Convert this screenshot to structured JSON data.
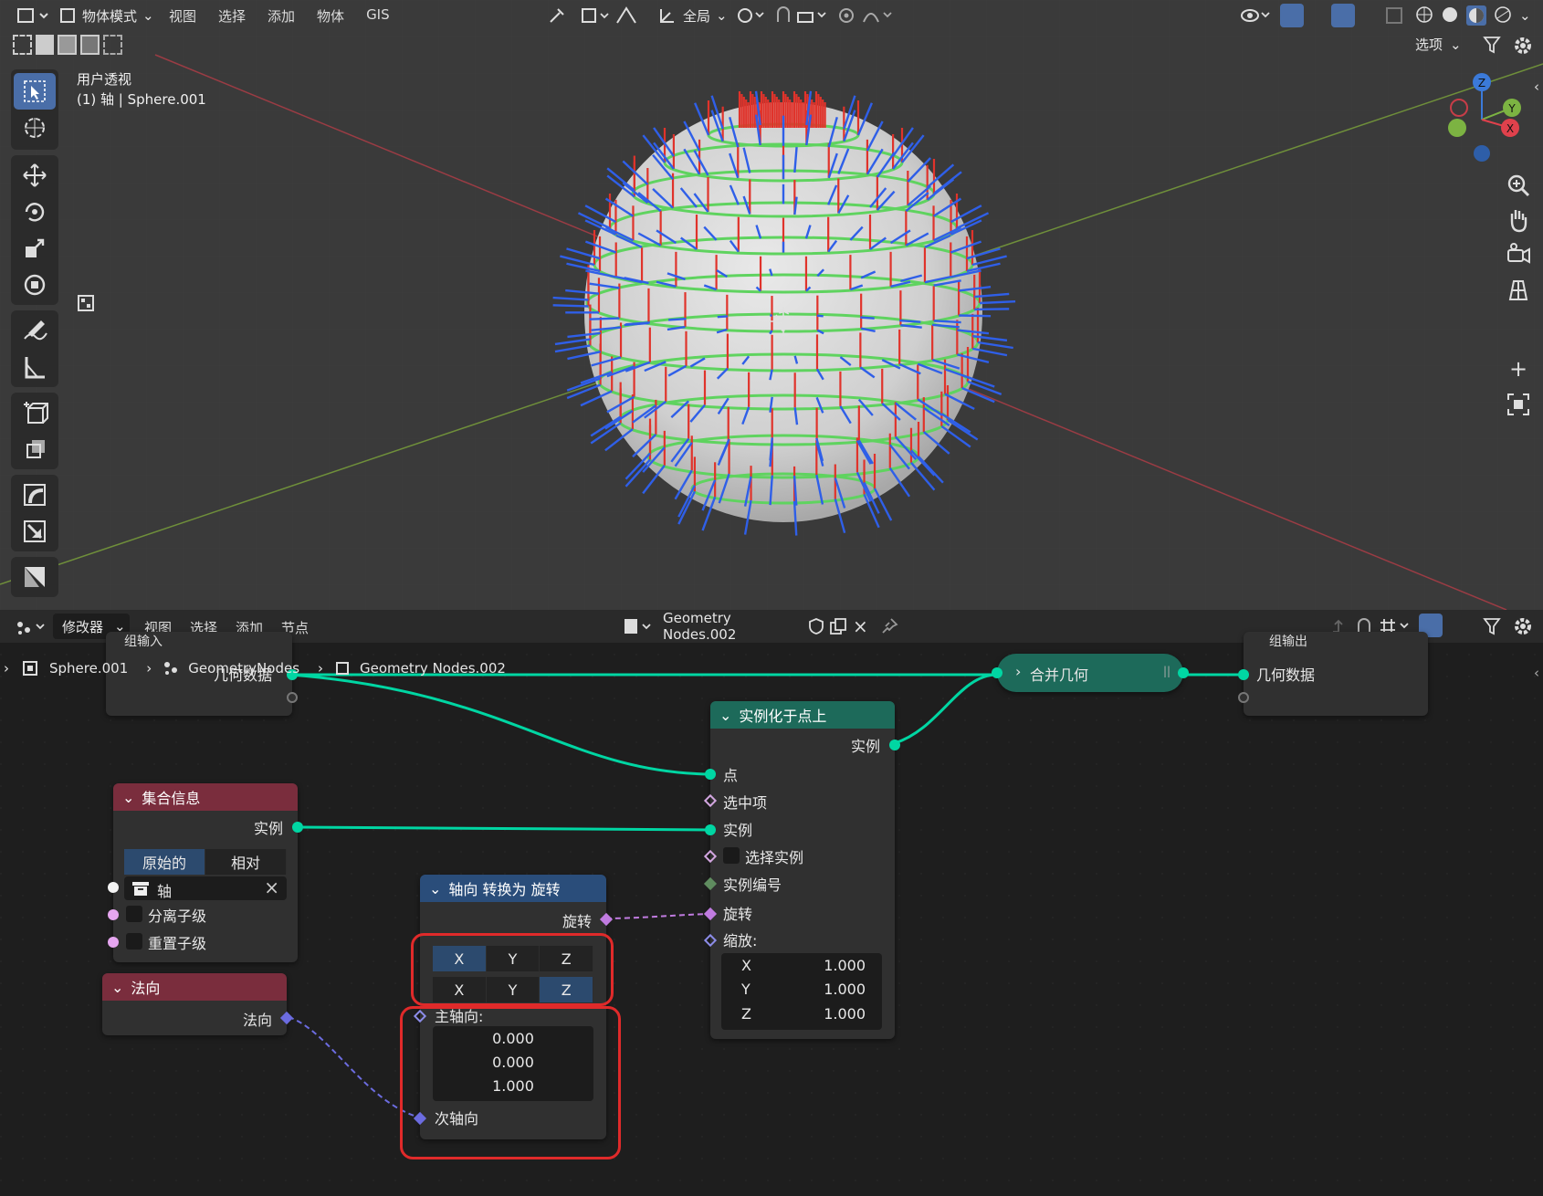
{
  "viewport_header": {
    "mode": "物体模式",
    "menus": [
      "视图",
      "选择",
      "添加",
      "物体",
      "GIS"
    ],
    "transform_orientation": "全局",
    "options_label": "选项"
  },
  "viewport": {
    "view_name": "用户透视",
    "object_info": "(1) 轴 | Sphere.001",
    "gizmo_axes": [
      "Z",
      "Y",
      "X"
    ]
  },
  "node_header": {
    "editor_type": "修改器",
    "menus": [
      "视图",
      "选择",
      "添加",
      "节点"
    ],
    "node_group": "Geometry Nodes.002"
  },
  "breadcrumb": {
    "object": "Sphere.001",
    "modifier": "GeometryNodes",
    "tree": "Geometry Nodes.002"
  },
  "nodes": {
    "group_input": {
      "title": "组输入",
      "geometry": "几何数据"
    },
    "join": {
      "title": "合并几何"
    },
    "group_output": {
      "title": "组输出",
      "geometry": "几何数据"
    },
    "instance_on_points": {
      "title": "实例化于点上",
      "output": "实例",
      "inputs": [
        "点",
        "选中项",
        "实例",
        "选择实例",
        "实例编号",
        "旋转",
        "缩放:"
      ],
      "scale": {
        "x_label": "X",
        "y_label": "Y",
        "z_label": "Z",
        "x": "1.000",
        "y": "1.000",
        "z": "1.000"
      }
    },
    "collection_info": {
      "title": "集合信息",
      "output": "实例",
      "transform_options": [
        "原始的",
        "相对"
      ],
      "collection": "轴",
      "separate_children": "分离子级",
      "reset_children": "重置子级"
    },
    "normal": {
      "title": "法向",
      "output": "法向"
    },
    "align_euler": {
      "title": "轴向 转换为 旋转",
      "output": "旋转",
      "axis_row1": [
        "X",
        "Y",
        "Z"
      ],
      "axis_row2": [
        "X",
        "Y",
        "Z"
      ],
      "primary_label": "主轴向:",
      "primary": [
        "0.000",
        "0.000",
        "1.000"
      ],
      "secondary_label": "次轴向"
    }
  },
  "colors": {
    "accent_blue": "#4a6ea8",
    "geometry_socket": "#00d6a3",
    "rotation_socket": "#c07be0",
    "vector_socket": "#6c6ce0",
    "integer_socket": "#5f8c5f",
    "highlight_red": "#e02a2a",
    "collection_header": "#7a2d3d",
    "input_header": "#7a2d3d",
    "converter_header": "#2a4d7a",
    "geometry_header": "#1d6a5a"
  }
}
